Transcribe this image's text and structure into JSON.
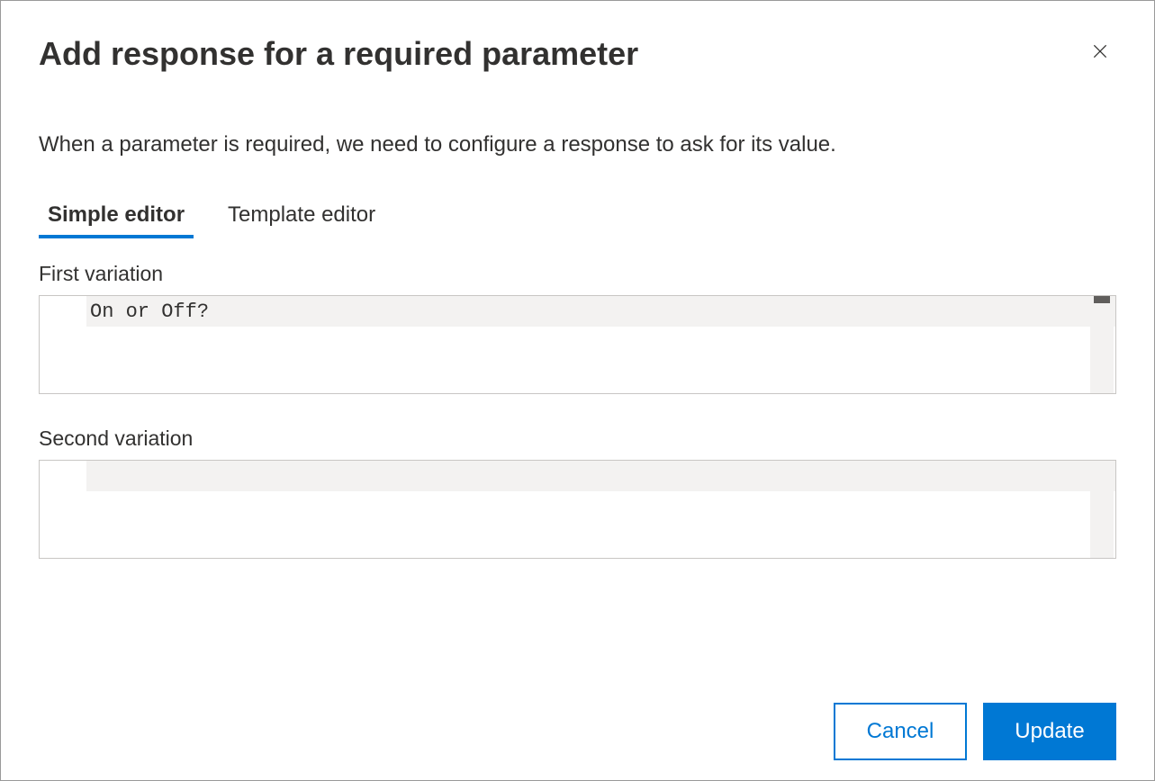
{
  "dialog": {
    "title": "Add response for a required parameter",
    "description": "When a parameter is required, we need to configure a response to ask for its value."
  },
  "tabs": {
    "simple": "Simple editor",
    "template": "Template editor"
  },
  "fields": {
    "first_variation": {
      "label": "First variation",
      "value": "On or Off?"
    },
    "second_variation": {
      "label": "Second variation",
      "value": ""
    }
  },
  "buttons": {
    "cancel": "Cancel",
    "update": "Update"
  }
}
